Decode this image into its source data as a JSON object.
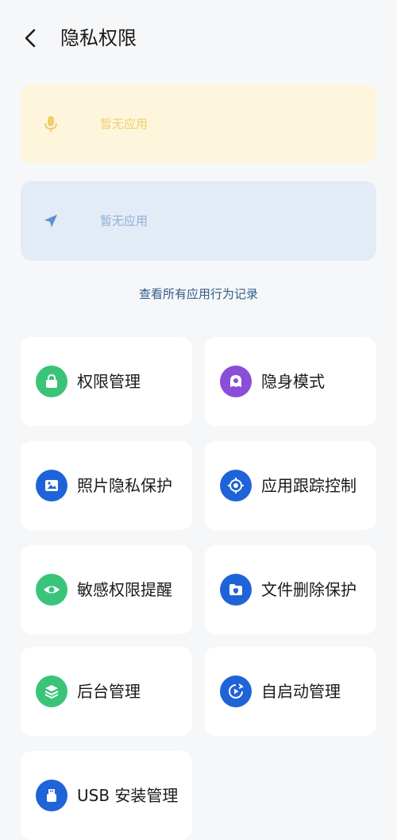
{
  "header": {
    "title": "隐私权限",
    "back_icon": "chevron-left-icon"
  },
  "usage": {
    "microphone": {
      "text": "暂无应用",
      "icon": "microphone-icon",
      "color": "#f0cf6c"
    },
    "location": {
      "text": "暂无应用",
      "icon": "location-arrow-icon",
      "color": "#8fb0da"
    }
  },
  "records_link": "查看所有应用行为记录",
  "colors": {
    "green": "#3ac47a",
    "purple": "#8a4ed8",
    "blue": "#1f63d8",
    "link": "#2f5b86"
  },
  "tiles": [
    {
      "label": "权限管理",
      "icon": "lock-icon"
    },
    {
      "label": "隐身模式",
      "icon": "incognito-icon"
    },
    {
      "label": "照片隐私保护",
      "icon": "photo-icon"
    },
    {
      "label": "应用跟踪控制",
      "icon": "crosshair-icon"
    },
    {
      "label": "敏感权限提醒",
      "icon": "eye-icon"
    },
    {
      "label": "文件删除保护",
      "icon": "folder-shield-icon"
    },
    {
      "label": "后台管理",
      "icon": "layers-icon"
    },
    {
      "label": "自启动管理",
      "icon": "autostart-icon"
    },
    {
      "label": "USB 安装管理",
      "icon": "usb-icon"
    }
  ]
}
